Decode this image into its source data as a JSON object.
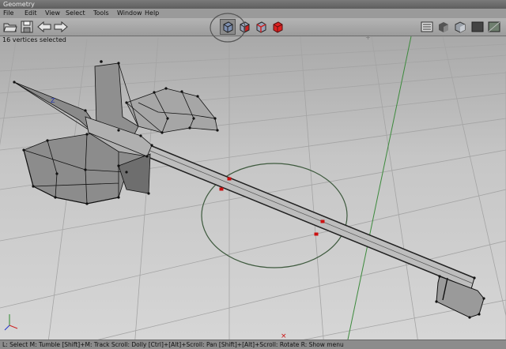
{
  "window": {
    "title": "Geometry"
  },
  "menu": [
    "File",
    "Edit",
    "View",
    "Select",
    "Tools",
    "Window",
    "Help"
  ],
  "toolbar": {
    "left": [
      {
        "name": "open-folder-icon"
      },
      {
        "name": "save-disk-icon"
      },
      {
        "name": "undo-arrow-icon"
      },
      {
        "name": "redo-arrow-icon"
      }
    ],
    "selection_modes": [
      {
        "name": "select-object-icon",
        "active": true
      },
      {
        "name": "select-face-icon",
        "active": false
      },
      {
        "name": "select-edge-icon",
        "active": false
      },
      {
        "name": "select-vertex-icon",
        "active": false
      }
    ],
    "shading": [
      {
        "name": "display-list-icon"
      },
      {
        "name": "shade-flat-icon"
      },
      {
        "name": "shade-smooth-icon"
      },
      {
        "name": "shade-dark-icon"
      },
      {
        "name": "shade-lit-icon"
      }
    ]
  },
  "viewport": {
    "selection_info": "16 vertices selected",
    "axis_label": "Z",
    "accent_selected": "#cc1111",
    "grid_color": "#9c9c9c"
  },
  "statusbar": {
    "text": "L: Select  M: Tumble  [Shift]+M: Track  Scroll: Dolly  [Ctrl]+[Alt]+Scroll: Pan  [Shift]+[Alt]+Scroll: Rotate  R: Show menu"
  }
}
